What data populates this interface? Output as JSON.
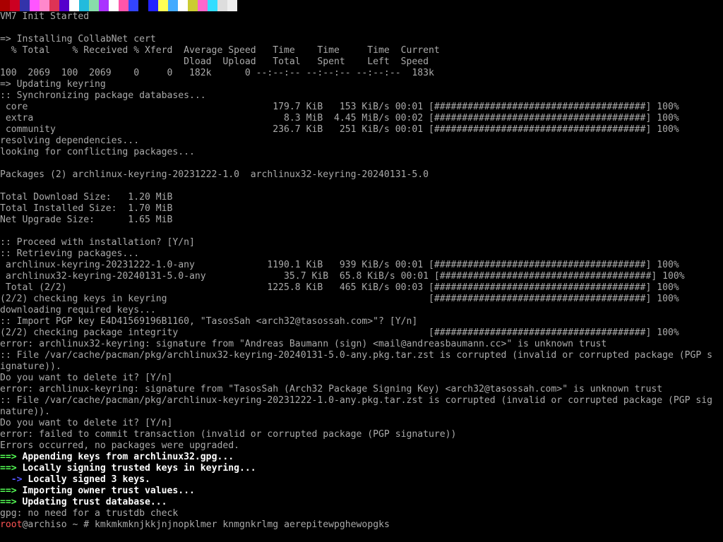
{
  "colors": {
    "background": "#000000",
    "text": "#aaaaaa",
    "arrow_green": "#55ff55",
    "arrow_blue": "#5555ff",
    "prompt_red": "#ff5555"
  },
  "colorbar": [
    "#aa0000",
    "#cc0022",
    "#3333aa",
    "#ff55ff",
    "#ff88cc",
    "#dd3355",
    "#5500cc",
    "#ffffff",
    "#22bbdd",
    "#88ddaa",
    "#aa33ff",
    "#ffffff",
    "#ff55aa",
    "#3344ff",
    "#000000",
    "#2222ff",
    "#ffff55",
    "#44aaff",
    "#ffffff",
    "#cccc33",
    "#ff66cc",
    "#33ddff",
    "#dddddd",
    "#eeeeee"
  ],
  "terminal": {
    "lines": [
      "VM7 Init Started",
      "",
      "=> Installing CollabNet cert",
      "  % Total    % Received % Xferd  Average Speed   Time    Time     Time  Current",
      "                                 Dload  Upload   Total   Spent    Left  Speed",
      "100  2069  100  2069    0     0   182k      0 --:--:-- --:--:-- --:--:--  183k",
      "=> Updating keyring",
      ":: Synchronizing package databases...",
      " core                                            179.7 KiB   153 KiB/s 00:01 [######################################] 100%",
      " extra                                             8.3 MiB  4.45 MiB/s 00:02 [######################################] 100%",
      " community                                       236.7 KiB   251 KiB/s 00:01 [######################################] 100%",
      "resolving dependencies...",
      "looking for conflicting packages...",
      "",
      "Packages (2) archlinux-keyring-20231222-1.0  archlinux32-keyring-20240131-5.0",
      "",
      "Total Download Size:   1.20 MiB",
      "Total Installed Size:  1.70 MiB",
      "Net Upgrade Size:      1.65 MiB",
      "",
      ":: Proceed with installation? [Y/n]",
      ":: Retrieving packages...",
      " archlinux-keyring-20231222-1.0-any             1190.1 KiB   939 KiB/s 00:01 [######################################] 100%",
      " archlinux32-keyring-20240131-5.0-any              35.7 KiB  65.8 KiB/s 00:01 [######################################] 100%",
      " Total (2/2)                                    1225.8 KiB   465 KiB/s 00:03 [######################################] 100%",
      "(2/2) checking keys in keyring                                               [######################################] 100%",
      "downloading required keys...",
      ":: Import PGP key E4D41569196B1160, \"TasosSah <arch32@tasossah.com>\"? [Y/n]",
      "(2/2) checking package integrity                                             [######################################] 100%",
      "error: archlinux32-keyring: signature from \"Andreas Baumann (sign) <mail@andreasbaumann.cc>\" is unknown trust",
      ":: File /var/cache/pacman/pkg/archlinux32-keyring-20240131-5.0-any.pkg.tar.zst is corrupted (invalid or corrupted package (PGP s",
      "ignature)).",
      "Do you want to delete it? [Y/n]",
      "error: archlinux-keyring: signature from \"TasosSah (Arch32 Package Signing Key) <arch32@tasossah.com>\" is unknown trust",
      ":: File /var/cache/pacman/pkg/archlinux-keyring-20231222-1.0-any.pkg.tar.zst is corrupted (invalid or corrupted package (PGP sig",
      "nature)).",
      "Do you want to delete it? [Y/n]",
      "error: failed to commit transaction (invalid or corrupted package (PGP signature))",
      "Errors occurred, no packages were upgraded."
    ],
    "keyring_steps": [
      {
        "arrow": "==>",
        "text": " Appending keys from archlinux32.gpg...",
        "level": "main"
      },
      {
        "arrow": "==>",
        "text": " Locally signing trusted keys in keyring...",
        "level": "main"
      },
      {
        "arrow": "  ->",
        "text": " Locally signed 3 keys.",
        "level": "sub"
      },
      {
        "arrow": "==>",
        "text": " Importing owner trust values...",
        "level": "main"
      },
      {
        "arrow": "==>",
        "text": " Updating trust database...",
        "level": "main"
      }
    ],
    "gpg_line": "gpg: no need for a trustdb check",
    "prompt": {
      "user": "root",
      "host": "@archiso",
      "path": " ~ # ",
      "command": "kmkmkmknjkkjnjnopklmer knmgnkrlmg aerepitewpghewopgks"
    }
  }
}
